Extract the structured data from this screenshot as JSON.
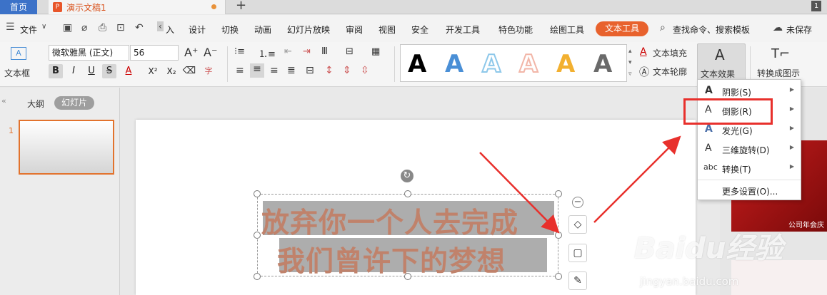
{
  "tabs": {
    "home": "首页",
    "doc_title": "演示文稿1",
    "new_tab": "+",
    "window_badge": "1"
  },
  "menu": {
    "file": "文件",
    "insert_partial": "入",
    "items": [
      "设计",
      "切换",
      "动画",
      "幻灯片放映",
      "审阅",
      "视图",
      "安全",
      "开发工具",
      "特色功能",
      "绘图工具",
      "文本工具"
    ],
    "search": "查找命令、搜索模板",
    "unsaved": "未保存"
  },
  "ribbon": {
    "textbox_label": "文本框",
    "font_name": "微软雅黑 (正文)",
    "font_size": "56",
    "bold": "B",
    "italic": "I",
    "underline": "U",
    "strike": "S",
    "superscript": "X²",
    "subscript": "X₂",
    "gallery": [
      {
        "letter": "A",
        "color": "#000000"
      },
      {
        "letter": "A",
        "color": "#4a8fd6"
      },
      {
        "letter": "A",
        "color": "#8ec8ea"
      },
      {
        "letter": "A",
        "color": "#f2b6a8"
      },
      {
        "letter": "A",
        "color": "#f2b030"
      },
      {
        "letter": "A",
        "color": "#6a6a6a"
      }
    ],
    "text_fill": "文本填充",
    "text_outline": "文本轮廓",
    "text_effect": "文本效果",
    "convert_to_graphic": "转换成图示"
  },
  "left_panel": {
    "outline_tab": "大纲",
    "slides_tab": "幻灯片",
    "slide_number": "1"
  },
  "slide": {
    "line1": "放弃你一个人去完成",
    "line2": "我们曾许下的梦想"
  },
  "dropdown": {
    "items": [
      {
        "icon": "A",
        "label": "阴影(S)",
        "submenu": true
      },
      {
        "icon": "A",
        "label": "倒影(R)",
        "submenu": true
      },
      {
        "icon": "A",
        "label": "发光(G)",
        "submenu": true
      },
      {
        "icon": "A",
        "label": "三维旋转(D)",
        "submenu": true
      },
      {
        "icon": "abc",
        "label": "转换(T)",
        "submenu": true
      },
      {
        "icon": "",
        "label": "更多设置(O)...",
        "submenu": false
      }
    ]
  },
  "right_panel": {
    "caption": "公司年会庆"
  },
  "watermark": {
    "brand": "Baidu经验",
    "url": "jingyan.baidu.com"
  },
  "colors": {
    "accent": "#e8622d",
    "home_tab": "#3c72c8",
    "highlight_box": "#e8302c",
    "arrow": "#e8302c"
  }
}
